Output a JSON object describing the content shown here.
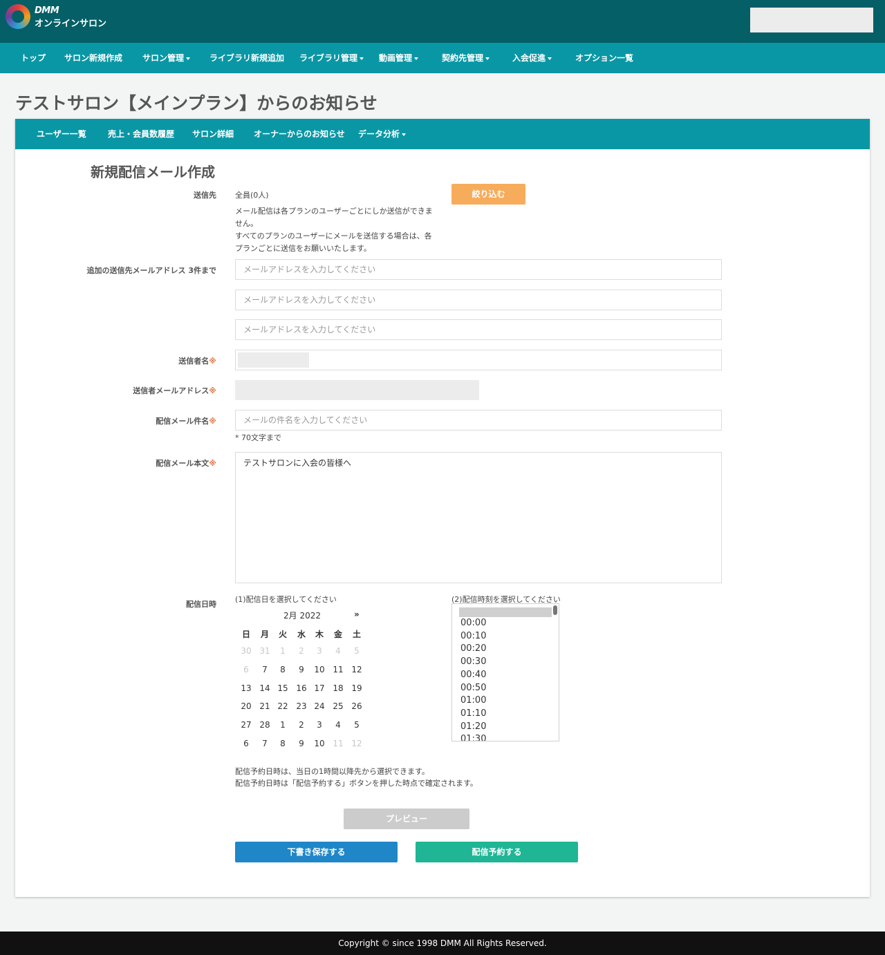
{
  "brand": {
    "logo_top": "DMM",
    "logo_sub": "オンラインサロン"
  },
  "main_nav": [
    {
      "label": "トップ",
      "dropdown": false
    },
    {
      "label": "サロン新規作成",
      "dropdown": false
    },
    {
      "label": "サロン管理",
      "dropdown": true
    },
    {
      "label": "ライブラリ新規追加",
      "dropdown": false
    },
    {
      "label": "ライブラリ管理",
      "dropdown": true
    },
    {
      "label": "動画管理",
      "dropdown": true
    },
    {
      "label": "契約先管理",
      "dropdown": true
    },
    {
      "label": "入会促進",
      "dropdown": true
    },
    {
      "label": "オプション一覧",
      "dropdown": false
    }
  ],
  "page_title": "テストサロン【メインプラン】からのお知らせ",
  "sub_nav": [
    {
      "label": "ユーザー一覧",
      "dropdown": false
    },
    {
      "label": "売上・会員数履歴",
      "dropdown": false
    },
    {
      "label": "サロン詳細",
      "dropdown": false
    },
    {
      "label": "オーナーからのお知らせ",
      "dropdown": false
    },
    {
      "label": "データ分析",
      "dropdown": true
    }
  ],
  "form": {
    "title": "新規配信メール作成",
    "recipients": {
      "label": "送信先",
      "value": "全員(0人)",
      "note_lines": [
        "メール配信は各プランのユーザーごとにしか送信ができま",
        "せん。",
        "すべてのプランのユーザーにメールを送信する場合は、各",
        "プランごとに送信をお願いいたします。"
      ],
      "filter_button": "絞り込む"
    },
    "extra_emails": {
      "label": "追加の送信先メールアドレス 3件まで",
      "placeholders": [
        "メールアドレスを入力してください",
        "メールアドレスを入力してください",
        "メールアドレスを入力してください"
      ]
    },
    "sender_name": {
      "label": "送信者名",
      "required_mark": "※"
    },
    "sender_email": {
      "label": "送信者メールアドレス",
      "required_mark": "※"
    },
    "subject": {
      "label": "配信メール件名",
      "required_mark": "※",
      "placeholder": "メールの件名を入力してください",
      "hint": "* 70文字まで"
    },
    "body": {
      "label": "配信メール本文",
      "required_mark": "※",
      "value": "テストサロンに入会の皆様へ"
    },
    "schedule": {
      "label": "配信日時",
      "date_prompt": "(1)配信日を選択してください",
      "time_prompt": "(2)配信時刻を選択してください",
      "calendar": {
        "month_label": "2月 2022",
        "next": "»",
        "weekdays": [
          "日",
          "月",
          "火",
          "水",
          "木",
          "金",
          "土"
        ],
        "weeks": [
          [
            {
              "d": "30",
              "m": 1
            },
            {
              "d": "31",
              "m": 1
            },
            {
              "d": "1",
              "m": 1
            },
            {
              "d": "2",
              "m": 1
            },
            {
              "d": "3",
              "m": 1
            },
            {
              "d": "4",
              "m": 1
            },
            {
              "d": "5",
              "m": 1
            }
          ],
          [
            {
              "d": "6",
              "m": 1
            },
            {
              "d": "7",
              "m": 0
            },
            {
              "d": "8",
              "m": 0
            },
            {
              "d": "9",
              "m": 0
            },
            {
              "d": "10",
              "m": 0
            },
            {
              "d": "11",
              "m": 0
            },
            {
              "d": "12",
              "m": 0
            }
          ],
          [
            {
              "d": "13",
              "m": 0
            },
            {
              "d": "14",
              "m": 0
            },
            {
              "d": "15",
              "m": 0
            },
            {
              "d": "16",
              "m": 0
            },
            {
              "d": "17",
              "m": 0
            },
            {
              "d": "18",
              "m": 0
            },
            {
              "d": "19",
              "m": 0
            }
          ],
          [
            {
              "d": "20",
              "m": 0
            },
            {
              "d": "21",
              "m": 0
            },
            {
              "d": "22",
              "m": 0
            },
            {
              "d": "23",
              "m": 0
            },
            {
              "d": "24",
              "m": 0
            },
            {
              "d": "25",
              "m": 0
            },
            {
              "d": "26",
              "m": 0
            }
          ],
          [
            {
              "d": "27",
              "m": 0
            },
            {
              "d": "28",
              "m": 0
            },
            {
              "d": "1",
              "m": 0
            },
            {
              "d": "2",
              "m": 0
            },
            {
              "d": "3",
              "m": 0
            },
            {
              "d": "4",
              "m": 0
            },
            {
              "d": "5",
              "m": 0
            }
          ],
          [
            {
              "d": "6",
              "m": 0
            },
            {
              "d": "7",
              "m": 0
            },
            {
              "d": "8",
              "m": 0
            },
            {
              "d": "9",
              "m": 0
            },
            {
              "d": "10",
              "m": 0
            },
            {
              "d": "11",
              "m": 1
            },
            {
              "d": "12",
              "m": 1
            }
          ]
        ]
      },
      "times": [
        "00:00",
        "00:10",
        "00:20",
        "00:30",
        "00:40",
        "00:50",
        "01:00",
        "01:10",
        "01:20",
        "01:30"
      ],
      "notes": [
        "配信予約日時は、当日の1時間以降先から選択できます。",
        "配信予約日時は「配信予約する」ボタンを押した時点で確定されます。"
      ]
    },
    "buttons": {
      "preview": "プレビュー",
      "save_draft": "下書き保存する",
      "schedule": "配信予約する"
    }
  },
  "colors": {
    "header": "#045f66",
    "nav": "#0a97a5",
    "filter_button": "#f7ac5b",
    "draft_button": "#1f86c8",
    "schedule_button": "#1fb595",
    "preview_button": "#cccccc"
  },
  "footer": "Copyright © since 1998 DMM All Rights Reserved."
}
